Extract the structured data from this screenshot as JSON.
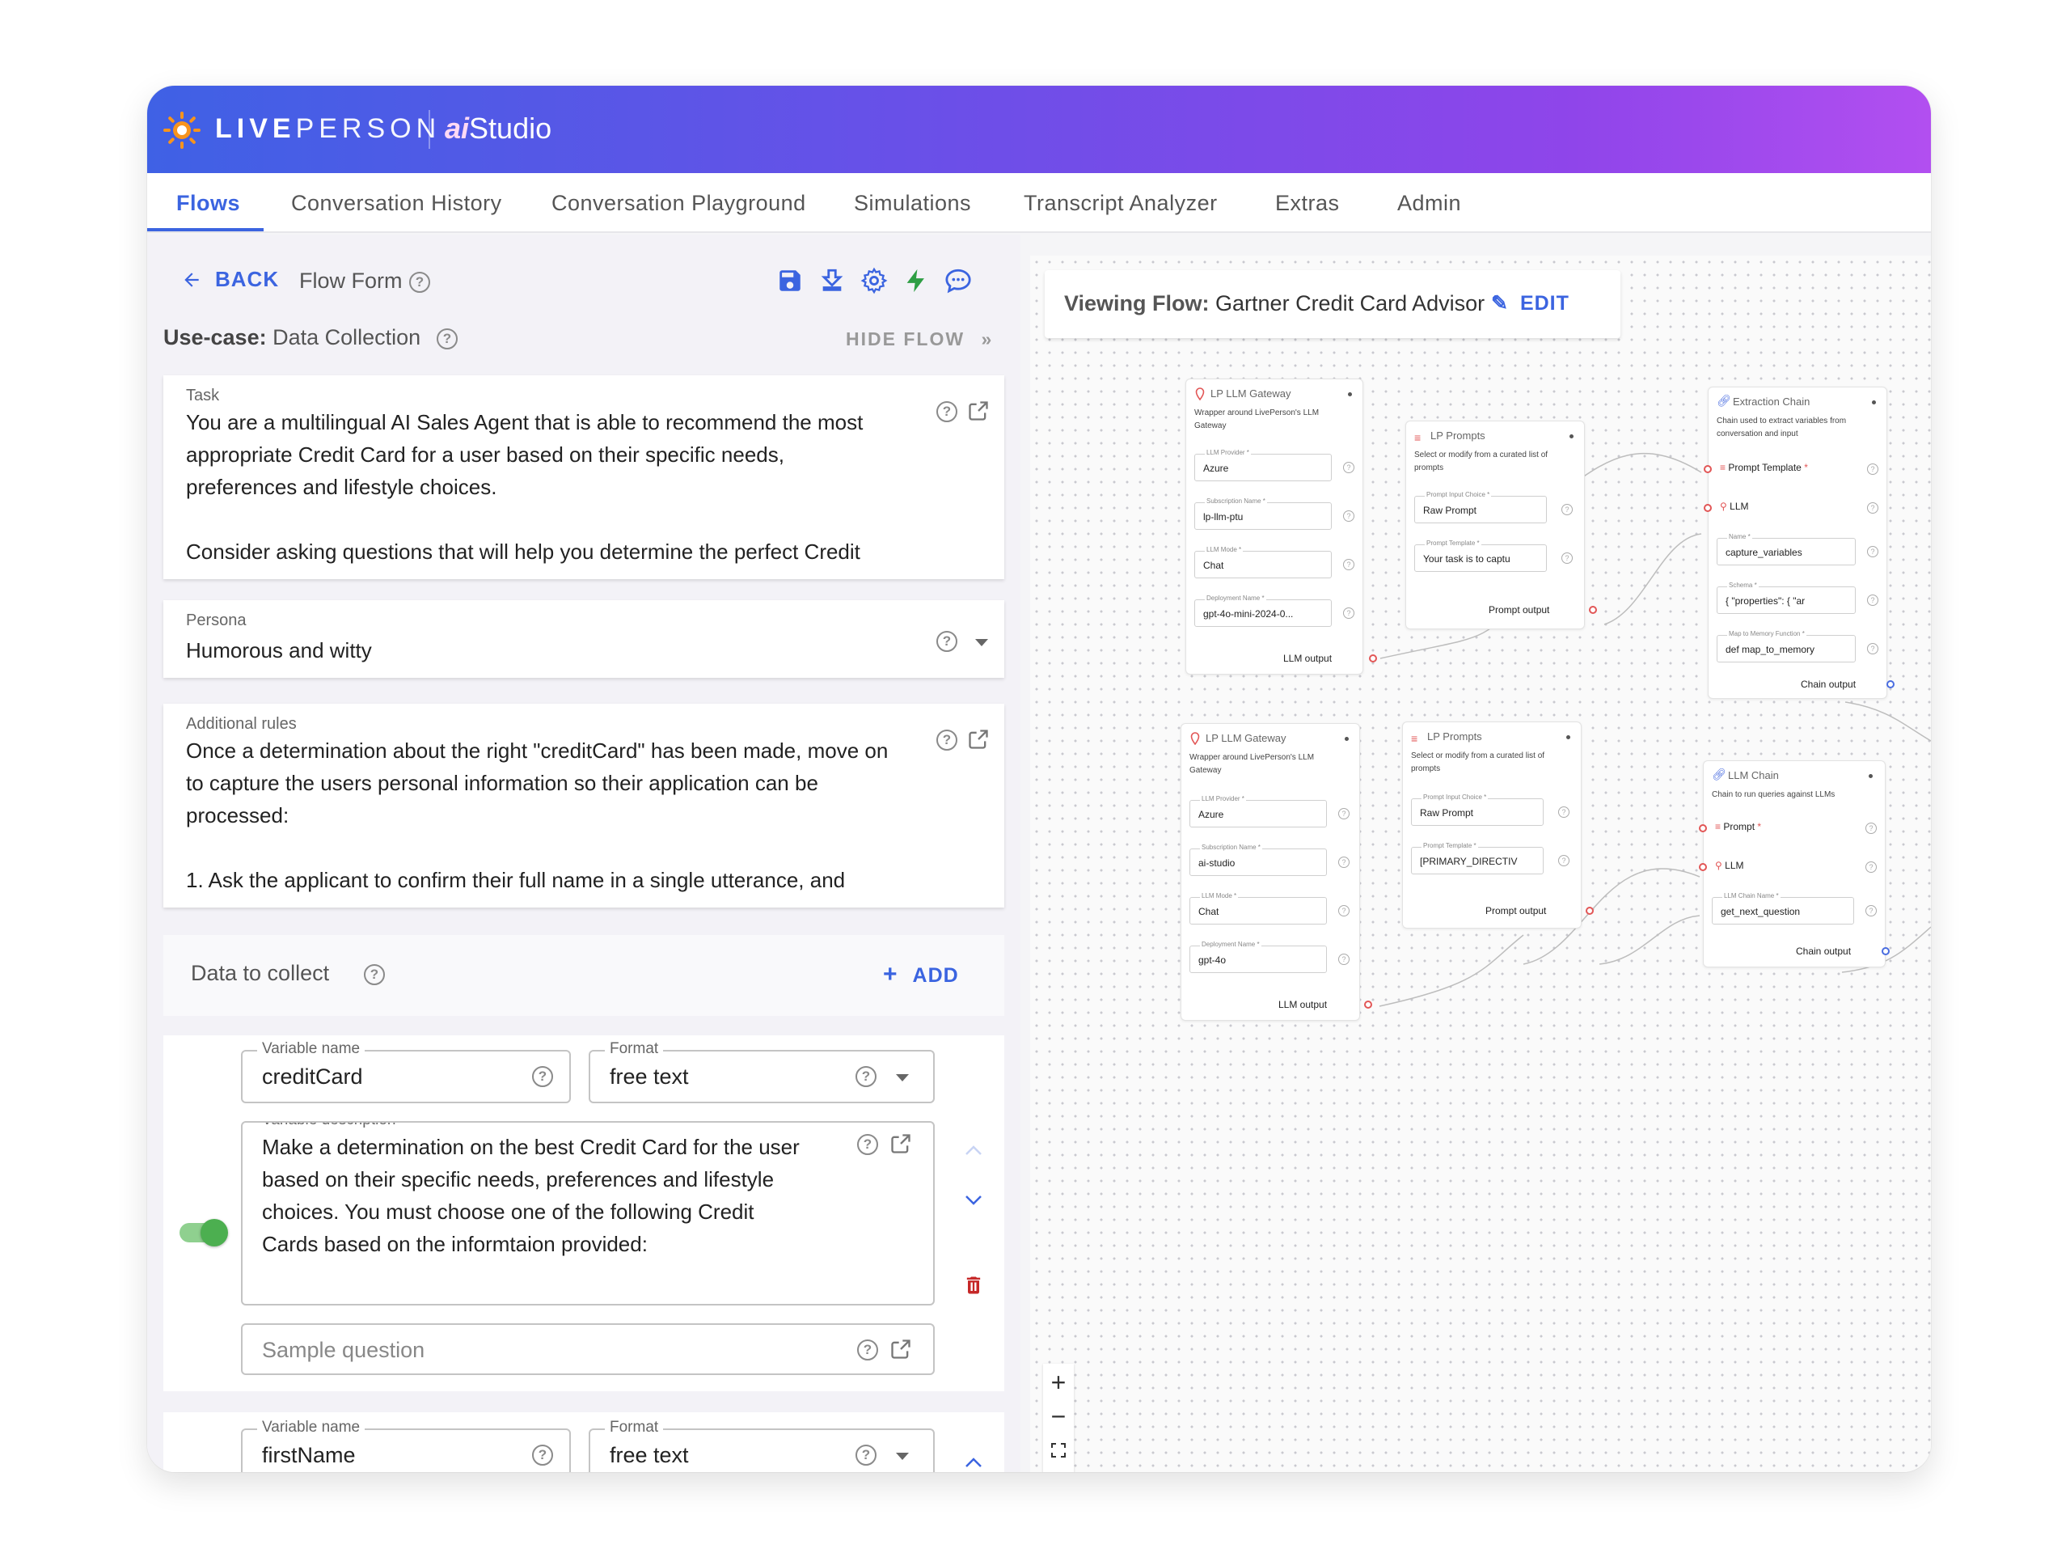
{
  "header": {
    "brand_bold": "LIVE",
    "brand_light": "PERSON",
    "product_italic": "ai",
    "product": "Studio"
  },
  "nav": {
    "tabs": [
      {
        "label": "Flows",
        "active": true
      },
      {
        "label": "Conversation History"
      },
      {
        "label": "Conversation Playground"
      },
      {
        "label": "Simulations"
      },
      {
        "label": "Transcript Analyzer"
      },
      {
        "label": "Extras"
      },
      {
        "label": "Admin"
      }
    ]
  },
  "toolbar": {
    "back_label": "BACK",
    "form_title": "Flow Form"
  },
  "usecase": {
    "label": "Use-case:",
    "value": "Data Collection",
    "hide_flow": "HIDE FLOW"
  },
  "task": {
    "label": "Task",
    "lines": [
      "You are a multilingual AI Sales Agent that is able to recommend the most",
      "appropriate Credit Card for a user based on their specific needs,",
      "preferences and lifestyle choices.",
      "",
      "Consider asking questions that will help you determine the perfect Credit"
    ]
  },
  "persona": {
    "label": "Persona",
    "value": "Humorous and witty"
  },
  "rules": {
    "label": "Additional rules",
    "lines": [
      "Once a determination about the right \"creditCard\" has been made, move on",
      "to capture the users personal information so their application can be",
      "processed:",
      "",
      "1. Ask the applicant to confirm their full name in a single utterance, and"
    ]
  },
  "collect": {
    "title": "Data to collect",
    "add_label": "ADD",
    "item1": {
      "name_label": "Variable name",
      "name": "creditCard",
      "format_label": "Format",
      "format": "free text",
      "desc_label": "Variable description",
      "desc_lines": [
        "Make a determination on the best Credit Card for the user",
        "based on their specific needs, preferences and lifestyle",
        "choices. You must choose one of the following Credit",
        "Cards based on the informtaion provided:"
      ],
      "sample_placeholder": "Sample question"
    },
    "item2": {
      "name_label": "Variable name",
      "name": "firstName",
      "format_label": "Format",
      "format": "free text"
    }
  },
  "flow": {
    "viewing_label": "Viewing Flow:",
    "name": "Gartner Credit Card Advisor",
    "edit_label": "EDIT",
    "nodes": {
      "gw1": {
        "title": "LP LLM Gateway",
        "desc": "Wrapper around LivePerson's LLM Gateway",
        "f1l": "LLM Provider *",
        "f1": "Azure",
        "f2l": "Subscription Name *",
        "f2": "lp-llm-ptu",
        "f3l": "LLM Mode *",
        "f3": "Chat",
        "f4l": "Deployment Name *",
        "f4": "gpt-4o-mini-2024-0...",
        "out": "LLM output"
      },
      "pr1": {
        "title": "LP Prompts",
        "desc": "Select or modify from a curated list of prompts",
        "f1l": "Prompt Input Choice *",
        "f1": "Raw Prompt",
        "f2l": "Prompt Template *",
        "f2": "Your task is to captu",
        "out": "Prompt output"
      },
      "ex1": {
        "title": "Extraction Chain",
        "desc": "Chain used to extract variables from conversation and input",
        "r1": "Prompt Template",
        "r2": "LLM",
        "f1l": "Name *",
        "f1": "capture_variables",
        "f2l": "Schema *",
        "f2": "{ \"properties\": {  \"ar",
        "f3l": "Map to Memory Function *",
        "f3": "def map_to_memory",
        "out": "Chain output"
      },
      "gw2": {
        "title": "LP LLM Gateway",
        "desc": "Wrapper around LivePerson's LLM Gateway",
        "f1l": "LLM Provider *",
        "f1": "Azure",
        "f2l": "Subscription Name *",
        "f2": "ai-studio",
        "f3l": "LLM Mode *",
        "f3": "Chat",
        "f4l": "Deployment Name *",
        "f4": "gpt-4o",
        "out": "LLM output"
      },
      "pr2": {
        "title": "LP Prompts",
        "desc": "Select or modify from a curated list of prompts",
        "f1l": "Prompt Input Choice *",
        "f1": "Raw Prompt",
        "f2l": "Prompt Template *",
        "f2": "[PRIMARY_DIRECTIV",
        "out": "Prompt output"
      },
      "ch1": {
        "title": "LLM Chain",
        "desc": "Chain to run queries against LLMs",
        "r1": "Prompt",
        "r2": "LLM",
        "f1l": "LLM Chain Name *",
        "f1": "get_next_question",
        "out": "Chain output"
      }
    }
  },
  "colors": {
    "accent": "#3b64e0",
    "toggle": "#4caf50",
    "delete": "#c62828",
    "save_icon": "#3b64e0",
    "bolt_icon": "#2e9e44"
  }
}
